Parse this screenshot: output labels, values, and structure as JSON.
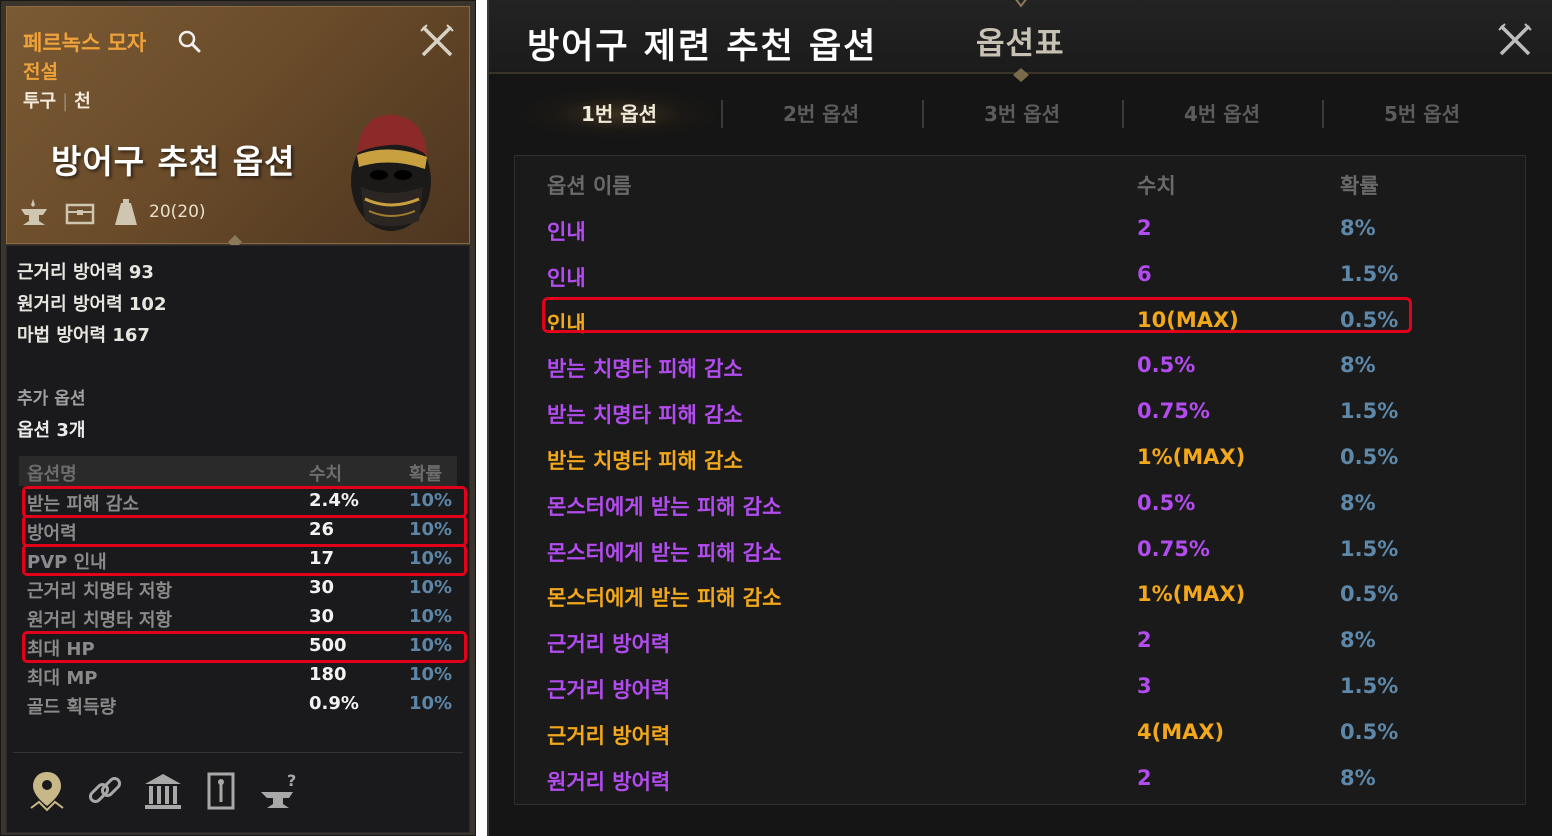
{
  "left": {
    "item_name": "페르녹스 모자",
    "grade": "전설",
    "type_part": "투구",
    "type_material": "천",
    "overlay_title": "방어구 추천 옵션",
    "weight": "20(20)",
    "stats": [
      "근거리 방어력 93",
      "원거리 방어력 102",
      "마법 방어력 167"
    ],
    "extra_options_label": "추가 옵션",
    "option_count": "옵션 3개",
    "table": {
      "headers": [
        "옵션명",
        "수치",
        "확률"
      ],
      "rows": [
        {
          "name": "받는 피해 감소",
          "value": "2.4%",
          "prob": "10%"
        },
        {
          "name": "방어력",
          "value": "26",
          "prob": "10%"
        },
        {
          "name": "PVP 인내",
          "value": "17",
          "prob": "10%"
        },
        {
          "name": "근거리 치명타 저항",
          "value": "30",
          "prob": "10%"
        },
        {
          "name": "원거리 치명타 저항",
          "value": "30",
          "prob": "10%"
        },
        {
          "name": "최대 HP",
          "value": "500",
          "prob": "10%"
        },
        {
          "name": "최대 MP",
          "value": "180",
          "prob": "10%"
        },
        {
          "name": "골드 획득량",
          "value": "0.9%",
          "prob": "10%"
        }
      ]
    }
  },
  "right": {
    "overlay_title": "방어구 제련 추천 옵션",
    "panel_title": "옵션표",
    "tabs": [
      {
        "label": "1번 옵션",
        "active": true
      },
      {
        "label": "2번 옵션",
        "active": false
      },
      {
        "label": "3번 옵션",
        "active": false
      },
      {
        "label": "4번 옵션",
        "active": false
      },
      {
        "label": "5번 옵션",
        "active": false
      }
    ],
    "table": {
      "headers": [
        "옵션 이름",
        "수치",
        "확률"
      ],
      "rows": [
        {
          "name": "인내",
          "value": "2",
          "prob": "8%",
          "tier": "purple"
        },
        {
          "name": "인내",
          "value": "6",
          "prob": "1.5%",
          "tier": "purple"
        },
        {
          "name": "인내",
          "value": "10(MAX)",
          "prob": "0.5%",
          "tier": "gold"
        },
        {
          "name": "받는 치명타 피해 감소",
          "value": "0.5%",
          "prob": "8%",
          "tier": "purple"
        },
        {
          "name": "받는 치명타 피해 감소",
          "value": "0.75%",
          "prob": "1.5%",
          "tier": "purple"
        },
        {
          "name": "받는 치명타 피해 감소",
          "value": "1%(MAX)",
          "prob": "0.5%",
          "tier": "gold"
        },
        {
          "name": "몬스터에게 받는 피해 감소",
          "value": "0.5%",
          "prob": "8%",
          "tier": "purple"
        },
        {
          "name": "몬스터에게 받는 피해 감소",
          "value": "0.75%",
          "prob": "1.5%",
          "tier": "purple"
        },
        {
          "name": "몬스터에게 받는 피해 감소",
          "value": "1%(MAX)",
          "prob": "0.5%",
          "tier": "gold"
        },
        {
          "name": "근거리 방어력",
          "value": "2",
          "prob": "8%",
          "tier": "purple"
        },
        {
          "name": "근거리 방어력",
          "value": "3",
          "prob": "1.5%",
          "tier": "purple"
        },
        {
          "name": "근거리 방어력",
          "value": "4(MAX)",
          "prob": "0.5%",
          "tier": "gold"
        },
        {
          "name": "원거리 방어력",
          "value": "2",
          "prob": "8%",
          "tier": "purple"
        }
      ]
    }
  },
  "colors": {
    "legendary": "#f0a23a",
    "purple_tier": "#b34cf0",
    "gold_tier": "#f2a81a",
    "probability": "#5e88aa",
    "highlight": "#e2001a"
  },
  "icons": {
    "header": [
      "magnifier-icon",
      "close-icon"
    ],
    "item_meta": [
      "anvil-icon",
      "chest-icon",
      "weight-icon"
    ],
    "bottom": [
      "map-pin-icon",
      "link-icon",
      "bank-icon",
      "scroll-icon",
      "anvil-question-icon"
    ]
  }
}
